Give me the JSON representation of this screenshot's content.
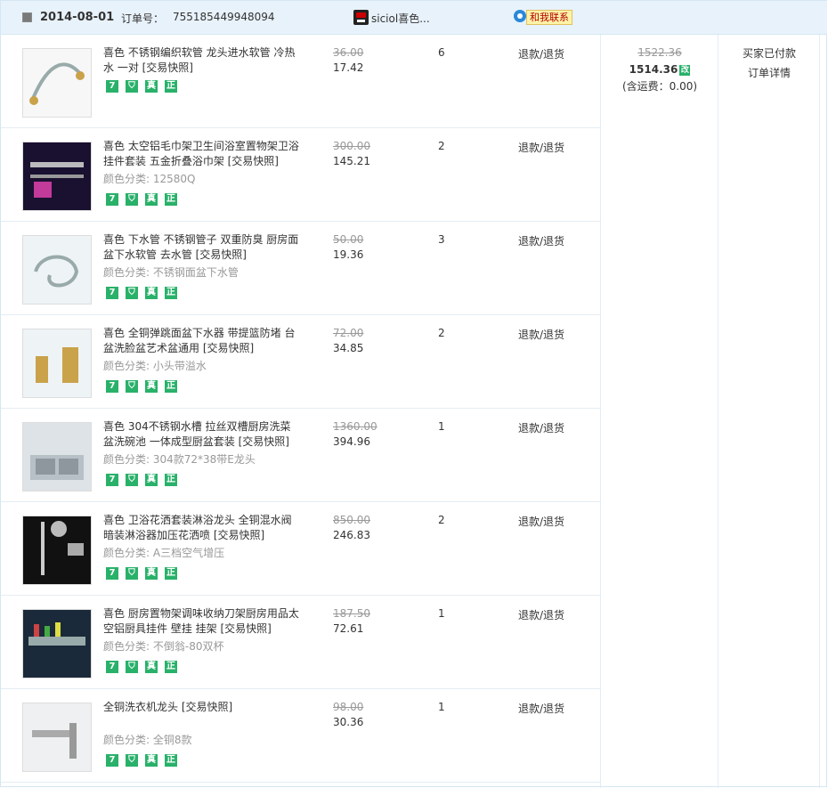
{
  "order": {
    "date": "2014-08-01",
    "order_no_label": "订单号：",
    "order_no": "755185449948094",
    "shop_name": "siciol喜色...",
    "chat_label": "和我联系",
    "original_total": "1522.36",
    "total": "1514.36",
    "edit_icon_text": "改",
    "shipping": "(含运费：0.00)",
    "status": "买家已付款",
    "detail_link": "订单详情",
    "refund_label": "退款/退货",
    "badges": [
      "7",
      "",
      "真",
      "正"
    ]
  },
  "items": [
    {
      "title": "喜色 不锈钢编织软管 龙头进水软管 冷热水 一对 [交易快照]",
      "sku": "",
      "orig": "36.00",
      "price": "17.42",
      "qty": "6"
    },
    {
      "title": "喜色 太空铝毛巾架卫生间浴室置物架卫浴挂件套装 五金折叠浴巾架 [交易快照]",
      "sku": "颜色分类: 12580Q",
      "orig": "300.00",
      "price": "145.21",
      "qty": "2"
    },
    {
      "title": "喜色 下水管 不锈钢管子 双重防臭 厨房面盆下水软管 去水管 [交易快照]",
      "sku": "颜色分类: 不锈钢面盆下水管",
      "orig": "50.00",
      "price": "19.36",
      "qty": "3"
    },
    {
      "title": "喜色 全铜弹跳面盆下水器 带提篮防堵 台盆洗脸盆艺术盆通用 [交易快照]",
      "sku": "颜色分类: 小头带溢水",
      "orig": "72.00",
      "price": "34.85",
      "qty": "2"
    },
    {
      "title": "喜色 304不锈钢水槽 拉丝双槽厨房洗菜盆洗碗池 一体成型厨盆套装 [交易快照]",
      "sku": "颜色分类: 304款72*38带E龙头",
      "orig": "1360.00",
      "price": "394.96",
      "qty": "1"
    },
    {
      "title": "喜色 卫浴花洒套装淋浴龙头 全铜混水阀暗装淋浴器加压花洒喷 [交易快照]",
      "sku": "颜色分类: A三档空气增压",
      "orig": "850.00",
      "price": "246.83",
      "qty": "2"
    },
    {
      "title": "喜色 厨房置物架调味收纳刀架厨房用品太空铝厨具挂件 壁挂 挂架 [交易快照]",
      "sku": "颜色分类: 不倒翁-80双杯",
      "orig": "187.50",
      "price": "72.61",
      "qty": "1"
    },
    {
      "title": "全铜洗衣机龙头 [交易快照]",
      "sku": "颜色分类: 全铜8款",
      "orig": "98.00",
      "price": "30.36",
      "qty": "1"
    }
  ]
}
